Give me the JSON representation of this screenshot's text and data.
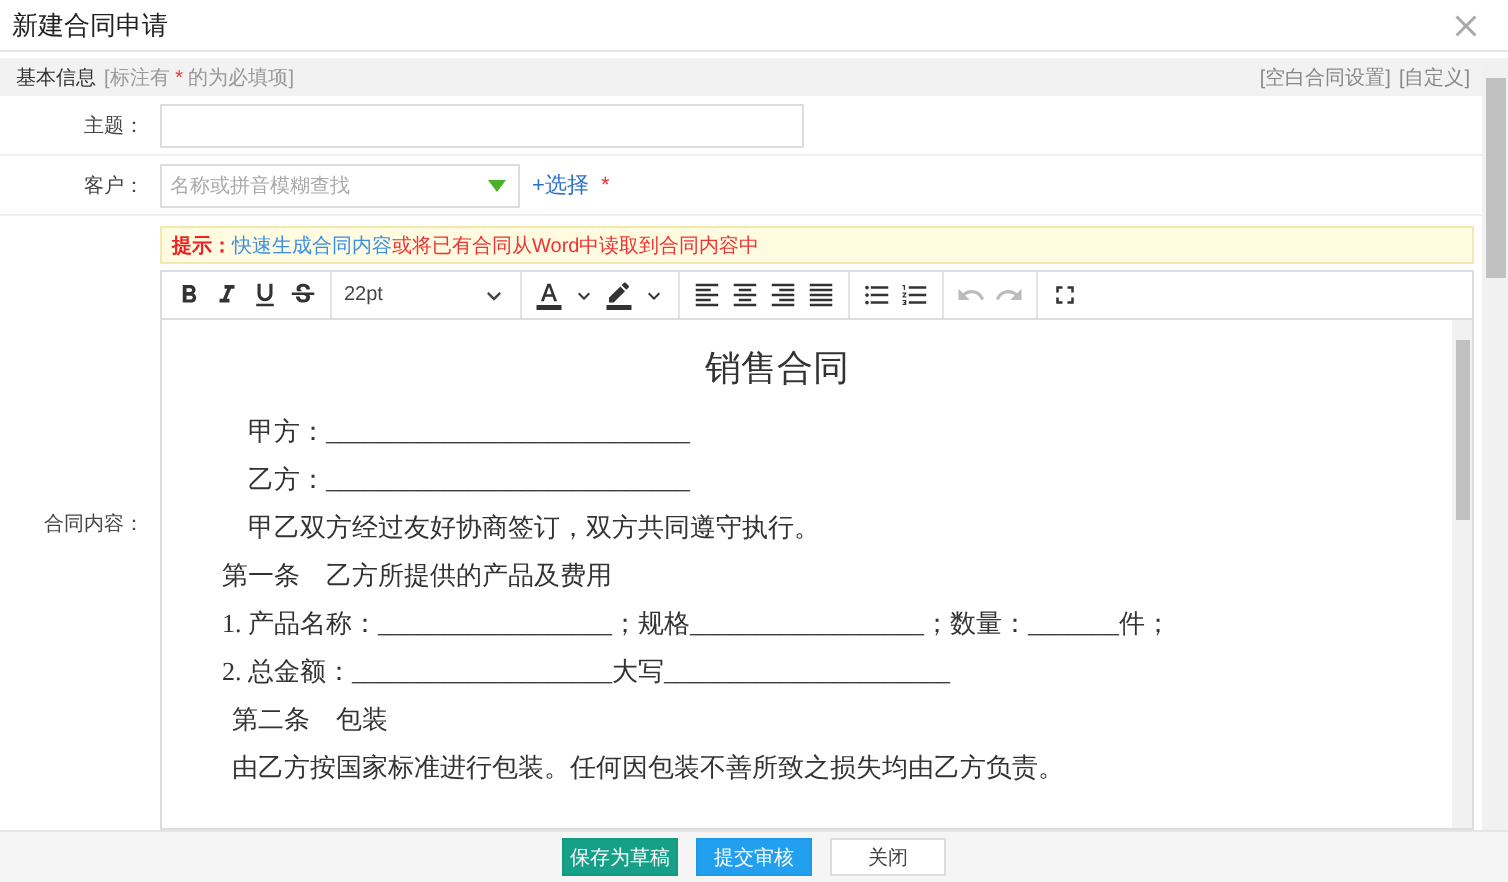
{
  "window": {
    "title": "新建合同申请"
  },
  "section": {
    "title": "基本信息",
    "note_before": "[标注有 ",
    "required_mark": "*",
    "note_after": " 的为必填项]",
    "links": [
      "[空白合同设置]",
      "[自定义]"
    ]
  },
  "fields": [
    {
      "kind": "text",
      "label": "主题："
    },
    {
      "kind": "select",
      "label": "客户：",
      "placeholder": "名称或拼音模糊查找",
      "action": "+选择",
      "required_mark": "*"
    }
  ],
  "content": {
    "label": "合同内容：",
    "tip": {
      "label": "提示：",
      "link": "快速生成合同内容",
      "text": "或将已有合同从Word中读取到合同内容中"
    },
    "toolbar": {
      "font_size": "22pt",
      "undo": {
        "disabled": true
      },
      "redo": {
        "disabled": true
      }
    },
    "document": [
      {
        "kind": "title",
        "text": "销售合同"
      },
      {
        "kind": "indented",
        "text": "甲方：____________________________"
      },
      {
        "kind": "indented",
        "text": "乙方：____________________________"
      },
      {
        "kind": "indented",
        "text": "甲乙双方经过友好协商签订，双方共同遵守执行。"
      },
      {
        "kind": "plain",
        "text": "第一条　乙方所提供的产品及费用"
      },
      {
        "kind": "plain",
        "text": "1.  产品名称：__________________；规格__________________；数量：_______件；"
      },
      {
        "kind": "plain",
        "text": "2.  总金额：____________________大写______________________"
      },
      {
        "kind": "section",
        "text": "第二条　包装"
      },
      {
        "kind": "section",
        "text": "由乙方按国家标准进行包装。任何因包装不善所致之损失均由乙方负责。"
      }
    ]
  },
  "buttons": [
    {
      "kind": "primary",
      "label": "保存为草稿"
    },
    {
      "kind": "info",
      "label": "提交审核"
    },
    {
      "kind": "default",
      "label": "关闭"
    }
  ]
}
